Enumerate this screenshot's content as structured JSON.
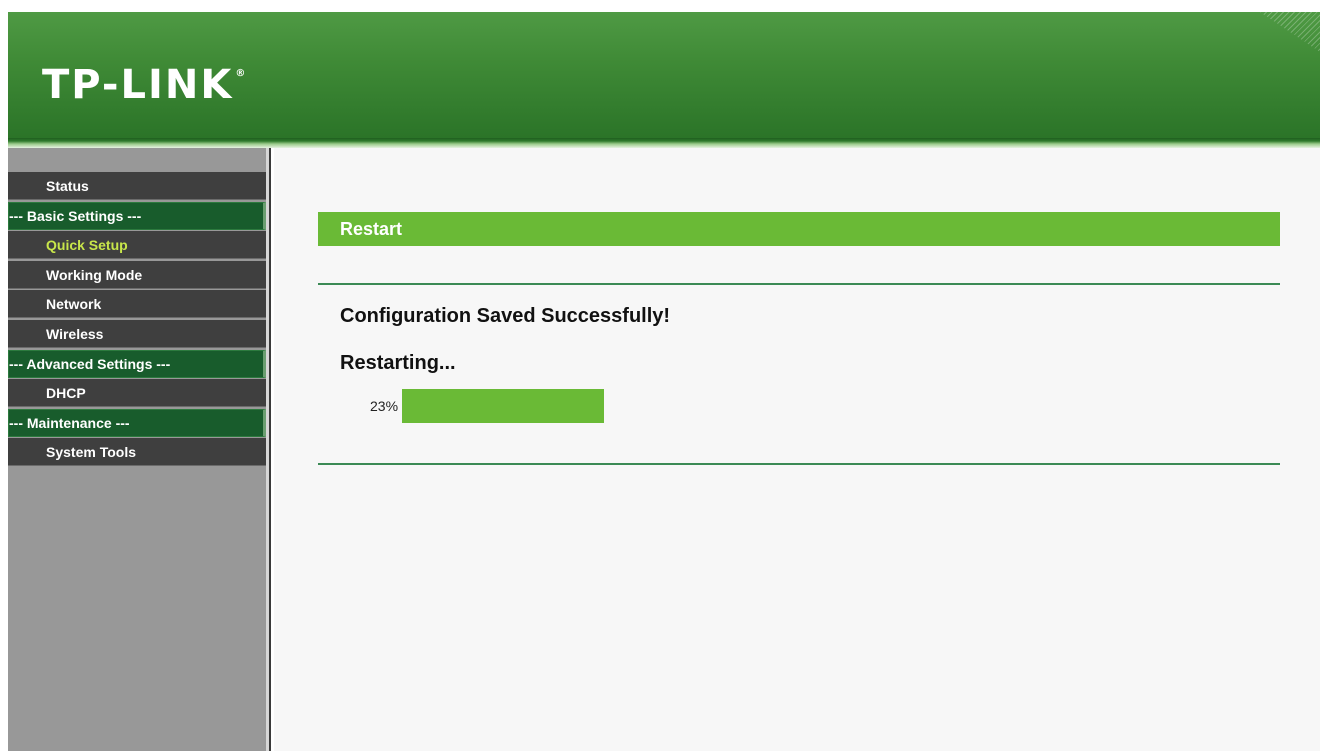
{
  "brand": {
    "logo_text": "TP-LINK",
    "registered_mark": "®"
  },
  "sidebar": {
    "items": [
      {
        "type": "item",
        "label": "Status",
        "active": false
      },
      {
        "type": "section",
        "label": "--- Basic Settings ---"
      },
      {
        "type": "item",
        "label": "Quick Setup",
        "active": true
      },
      {
        "type": "item",
        "label": "Working Mode",
        "active": false
      },
      {
        "type": "item",
        "label": "Network",
        "active": false
      },
      {
        "type": "item",
        "label": "Wireless",
        "active": false
      },
      {
        "type": "section",
        "label": "--- Advanced Settings ---"
      },
      {
        "type": "item",
        "label": "DHCP",
        "active": false
      },
      {
        "type": "section",
        "label": "--- Maintenance ---"
      },
      {
        "type": "item",
        "label": "System Tools",
        "active": false
      }
    ]
  },
  "main": {
    "title": "Restart",
    "message": "Configuration Saved Successfully!",
    "status": "Restarting...",
    "progress": {
      "label": "23%",
      "value": 0.23
    }
  },
  "colors": {
    "accent_green": "#6aba36",
    "section_green": "#185c2c",
    "active_item_text": "#c8e64a"
  }
}
